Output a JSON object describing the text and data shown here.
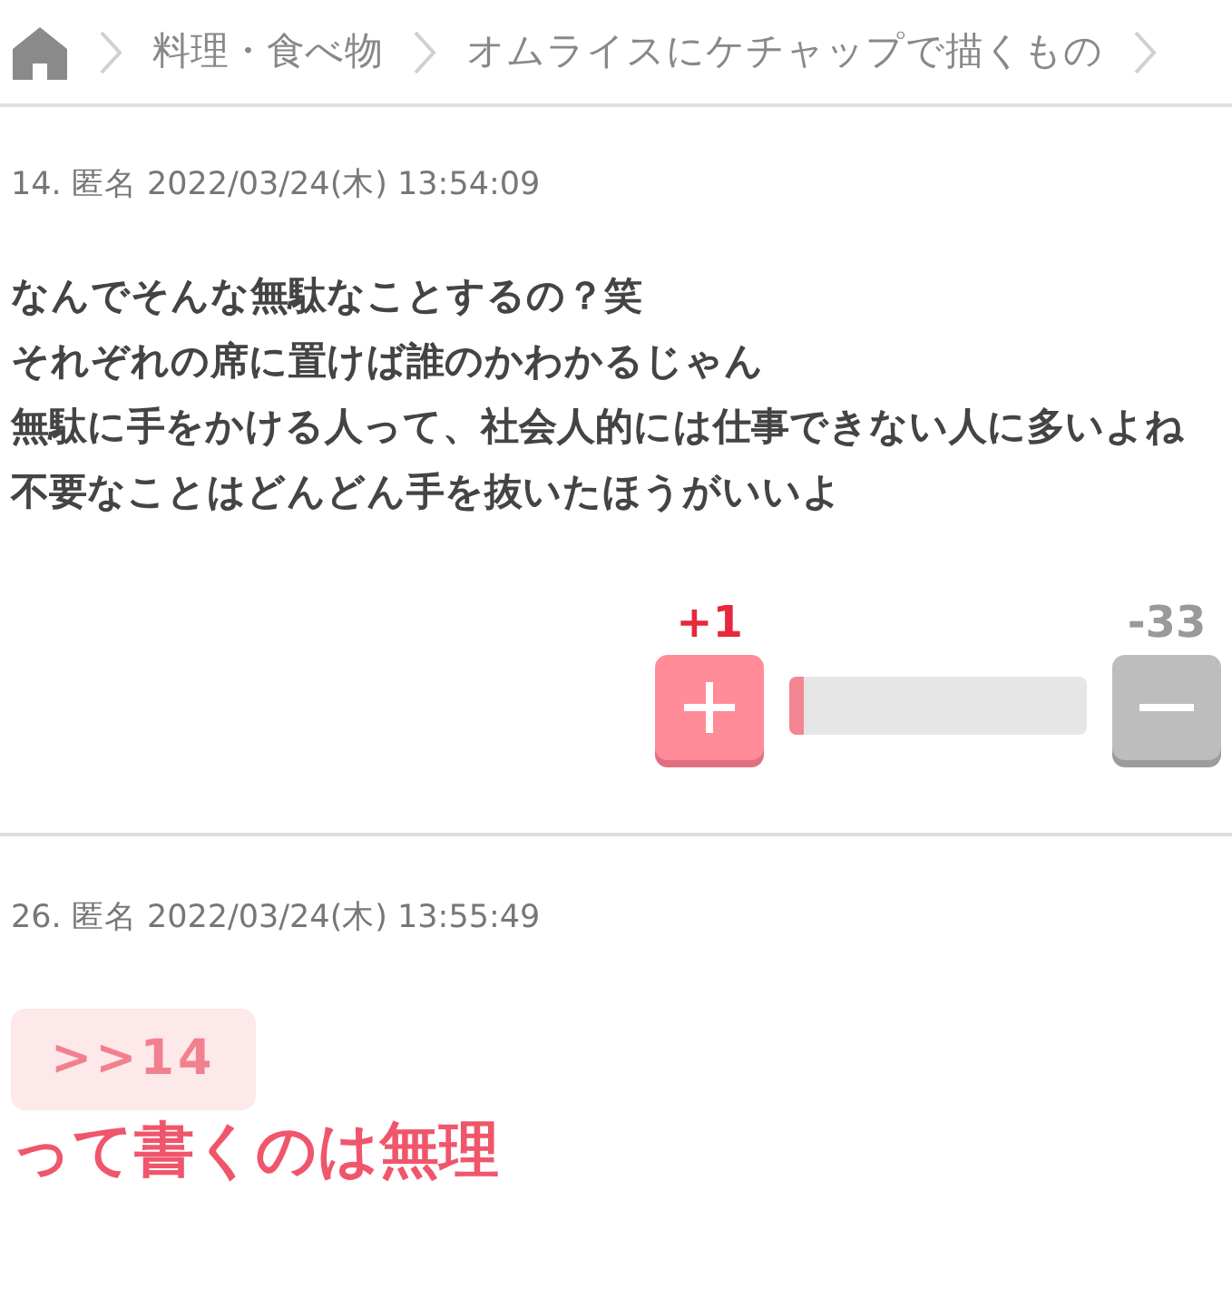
{
  "breadcrumb": [
    "料理・食べ物",
    "オムライスにケチャップで描くもの"
  ],
  "comments": [
    {
      "kind": "plain",
      "number": "14.",
      "author": "匿名",
      "datetime": "2022/03/24(木) 13:54:09",
      "body": [
        "なんでそんな無駄なことするの？笑",
        "それぞれの席に置けば誰のかわかるじゃん",
        "無駄に手をかける人って、社会人的には仕事できない人に多いよね",
        "不要なことはどんどん手を抜いたほうがいいよ"
      ],
      "vote": {
        "plus": "+1",
        "minus": "-33",
        "level": 0.05
      }
    },
    {
      "kind": "emphasis",
      "number": "26.",
      "author": "匿名",
      "datetime": "2022/03/24(木) 13:55:49",
      "anchor": ">>14",
      "body": [
        "って書くのは無理"
      ]
    }
  ]
}
